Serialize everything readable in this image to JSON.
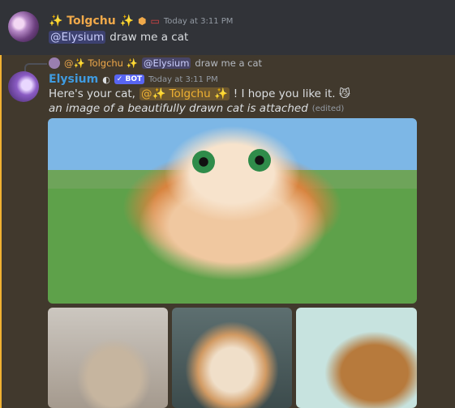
{
  "message1": {
    "username": "✨ Tolgchu ✨",
    "timestamp": "Today at 3:11 PM",
    "mention": "@Elysium",
    "text": "draw me a cat"
  },
  "message2": {
    "reply": {
      "author": "@✨ Tolgchu ✨",
      "mention": "@Elysium",
      "text": "draw me a cat"
    },
    "username": "Elysium",
    "bot_tag": "✓ BOT",
    "timestamp": "Today at 3:11 PM",
    "line1_prefix": "Here's your cat,",
    "line1_mention": "@✨ Tolgchu ✨",
    "line1_suffix": "! I hope you like it. 😼",
    "line2": "an image of a beautifully drawn cat is attached",
    "edited": "(edited)"
  },
  "colors": {
    "accent": "#f0b132",
    "bot": "#5865f2",
    "mention": "#c9cdfb"
  }
}
